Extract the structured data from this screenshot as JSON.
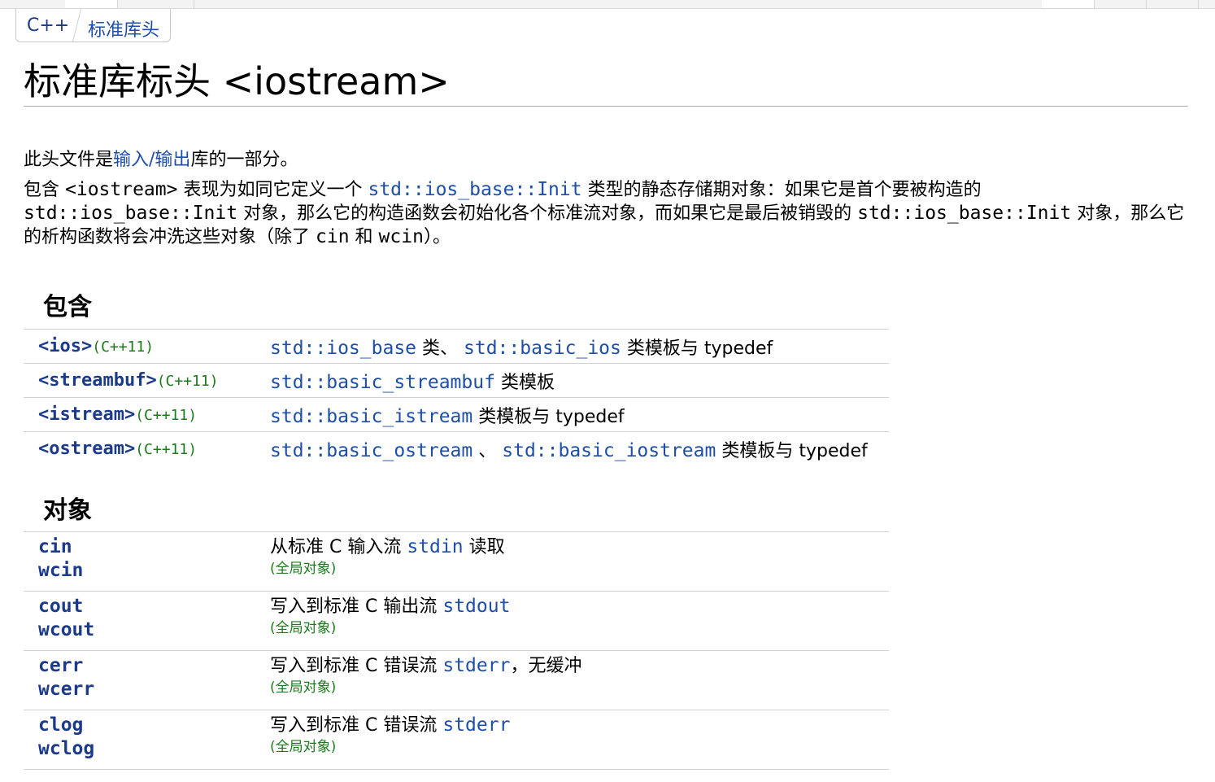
{
  "breadcrumb": {
    "root": "C++",
    "current": "标准库头"
  },
  "title": {
    "prefix": "标准库标头",
    "header": "<iostream>"
  },
  "intro": {
    "before": "此头文件是",
    "link": "输入/输出",
    "after": "库的一部分。"
  },
  "desc": {
    "t1": "包含 ",
    "c1": "<iostream>",
    "t2": " 表现为如同它定义一个 ",
    "link1": "std::ios_base::Init",
    "t3": " 类型的静态存储期对象：如果它是首个要被构造的 ",
    "c2": "std::ios_base::Init",
    "t4": " 对象，那么它的构造函数会初始化各个标准流对象，而如果它是最后被销毁的 ",
    "c3": "std::ios_base::Init",
    "t5": " 对象，那么它的析构函数将会冲洗这些对象（除了 ",
    "c4": "cin",
    "t6": " 和 ",
    "c5": "wcin",
    "t7": "）。"
  },
  "includes": {
    "heading": "包含",
    "rows": [
      {
        "header": "<ios>",
        "version": "(C++11)",
        "p1": "std::ios_base",
        "s1": " 类、 ",
        "p2": "std::basic_ios",
        "s2": " 类模板与 typedef"
      },
      {
        "header": "<streambuf>",
        "version": "(C++11)",
        "p1": "std::basic_streambuf",
        "s1": " 类模板",
        "p2": "",
        "s2": ""
      },
      {
        "header": "<istream>",
        "version": "(C++11)",
        "p1": "std::basic_istream",
        "s1": " 类模板与 typedef",
        "p2": "",
        "s2": ""
      },
      {
        "header": "<ostream>",
        "version": "(C++11)",
        "p1": "std::basic_ostream",
        "s1": " 、 ",
        "p2": "std::basic_iostream",
        "s2": " 类模板与 typedef"
      }
    ]
  },
  "objects": {
    "heading": "对象",
    "rows": [
      {
        "n1": "cin",
        "n2": "wcin",
        "d1": "从标准 C 输入流 ",
        "code": "stdin",
        "d2": " 读取",
        "note": "(全局对象)"
      },
      {
        "n1": "cout",
        "n2": "wcout",
        "d1": "写入到标准 C 输出流 ",
        "code": "stdout",
        "d2": "",
        "note": "(全局对象)"
      },
      {
        "n1": "cerr",
        "n2": "wcerr",
        "d1": "写入到标准 C 错误流 ",
        "code": "stderr",
        "d2": "，无缓冲",
        "note": "(全局对象)"
      },
      {
        "n1": "clog",
        "n2": "wclog",
        "d1": "写入到标准 C 错误流 ",
        "code": "stderr",
        "d2": "",
        "note": "(全局对象)"
      }
    ]
  }
}
